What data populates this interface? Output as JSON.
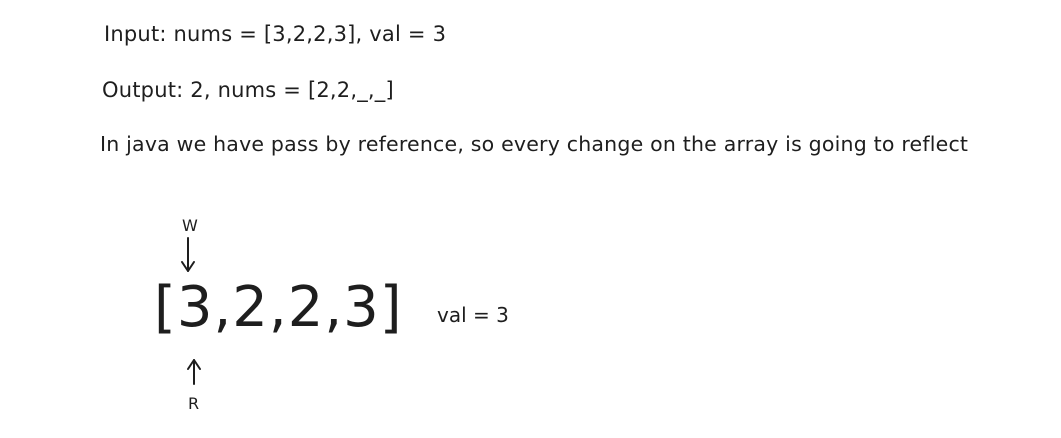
{
  "text": {
    "input_line": "Input: nums = [3,2,2,3], val = 3",
    "output_line": "Output: 2, nums = [2,2,_,_]",
    "note_line": "In java we have pass by reference, so every change on the array is going to reflect"
  },
  "diagram": {
    "array": "[3,2,2,3]",
    "val": "val = 3",
    "write_pointer_label": "W",
    "read_pointer_label": "R"
  },
  "colors": {
    "ink": "#1e1e1e",
    "background": "#ffffff"
  }
}
